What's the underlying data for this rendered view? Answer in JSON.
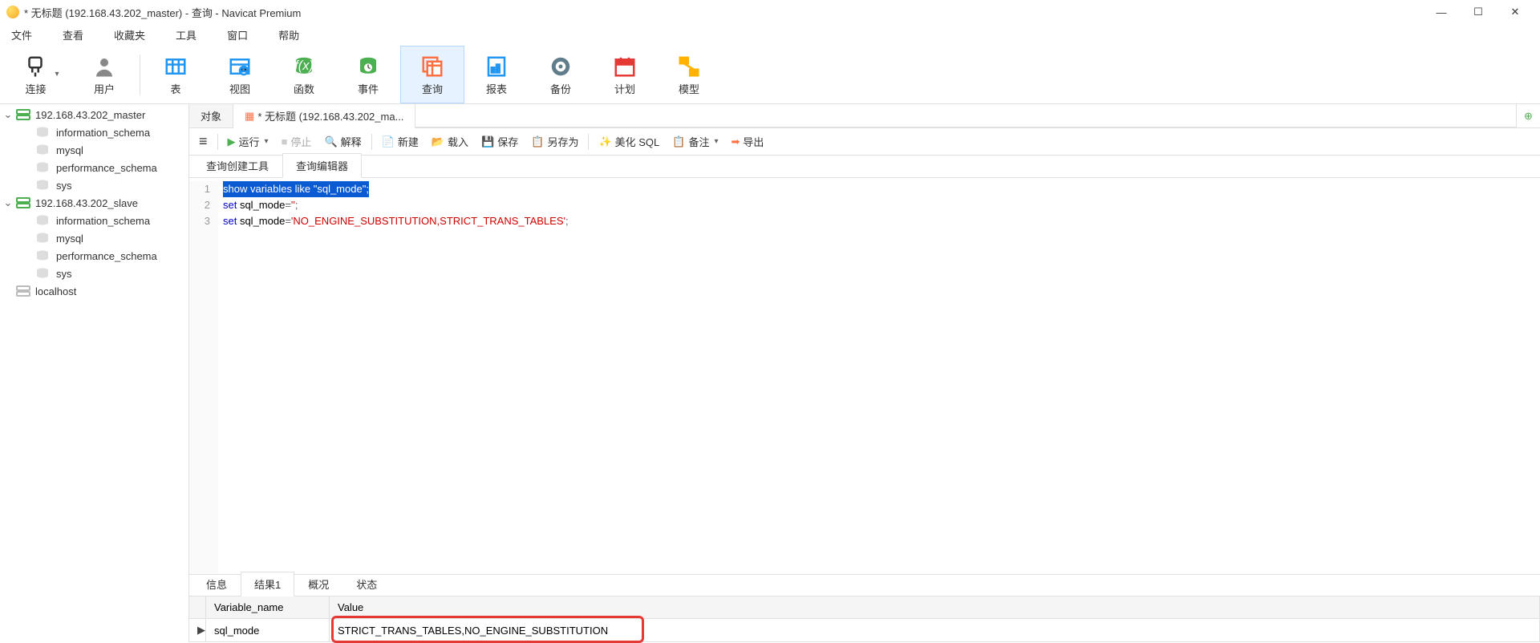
{
  "window": {
    "title": "* 无标题 (192.168.43.202_master) - 查询 - Navicat Premium"
  },
  "menu": [
    "文件",
    "查看",
    "收藏夹",
    "工具",
    "窗口",
    "帮助"
  ],
  "toolbar": [
    {
      "label": "连接",
      "icon": "plug",
      "color": "#333"
    },
    {
      "label": "用户",
      "icon": "user",
      "color": "#888"
    },
    {
      "label": "表",
      "icon": "table",
      "color": "#2196f3"
    },
    {
      "label": "视图",
      "icon": "view",
      "color": "#2196f3"
    },
    {
      "label": "函数",
      "icon": "fx",
      "color": "#4caf50"
    },
    {
      "label": "事件",
      "icon": "event",
      "color": "#4caf50"
    },
    {
      "label": "查询",
      "icon": "query",
      "color": "#ff7043",
      "active": true
    },
    {
      "label": "报表",
      "icon": "report",
      "color": "#2196f3"
    },
    {
      "label": "备份",
      "icon": "backup",
      "color": "#607d8b"
    },
    {
      "label": "计划",
      "icon": "schedule",
      "color": "#e53935"
    },
    {
      "label": "模型",
      "icon": "model",
      "color": "#ffb300"
    }
  ],
  "sidebar": {
    "connections": [
      {
        "name": "192.168.43.202_master",
        "open": true,
        "color": "green",
        "schemas": [
          "information_schema",
          "mysql",
          "performance_schema",
          "sys"
        ]
      },
      {
        "name": "192.168.43.202_slave",
        "open": true,
        "color": "green",
        "schemas": [
          "information_schema",
          "mysql",
          "performance_schema",
          "sys"
        ]
      },
      {
        "name": "localhost",
        "open": false,
        "color": "grey",
        "schemas": []
      }
    ]
  },
  "tabs": {
    "items": [
      {
        "label": "对象"
      },
      {
        "label": "* 无标题 (192.168.43.202_ma...",
        "active": true,
        "icon": "query"
      }
    ]
  },
  "query_toolbar": {
    "run": "运行",
    "stop": "停止",
    "explain": "解释",
    "new": "新建",
    "load": "载入",
    "save": "保存",
    "saveas": "另存为",
    "beautify": "美化 SQL",
    "notes": "备注",
    "export": "导出",
    "menu": "≡"
  },
  "inner_tabs": [
    "查询创建工具",
    "查询编辑器"
  ],
  "inner_tab_active": 1,
  "editor": {
    "lines": [
      {
        "n": 1,
        "tokens": [
          {
            "t": "show variables like ",
            "c": "kw"
          },
          {
            "t": "\"sql_mode\"",
            "c": "str"
          },
          {
            "t": ";",
            "c": "sym"
          }
        ],
        "selected": true
      },
      {
        "n": 2,
        "tokens": [
          {
            "t": "set",
            "c": "kw"
          },
          {
            "t": " sql_mode",
            "c": ""
          },
          {
            "t": "=",
            "c": "op"
          },
          {
            "t": "''",
            "c": "str"
          },
          {
            "t": ";",
            "c": "sym"
          }
        ]
      },
      {
        "n": 3,
        "tokens": [
          {
            "t": "set",
            "c": "kw"
          },
          {
            "t": " sql_mode",
            "c": ""
          },
          {
            "t": "=",
            "c": "op"
          },
          {
            "t": "'NO_ENGINE_SUBSTITUTION,STRICT_TRANS_TABLES'",
            "c": "str"
          },
          {
            "t": ";",
            "c": "sym"
          }
        ]
      }
    ]
  },
  "result_tabs": [
    "信息",
    "结果1",
    "概况",
    "状态"
  ],
  "result_tab_active": 1,
  "result": {
    "columns": [
      "Variable_name",
      "Value"
    ],
    "rows": [
      {
        "Variable_name": "sql_mode",
        "Value": "STRICT_TRANS_TABLES,NO_ENGINE_SUBSTITUTION"
      }
    ]
  }
}
